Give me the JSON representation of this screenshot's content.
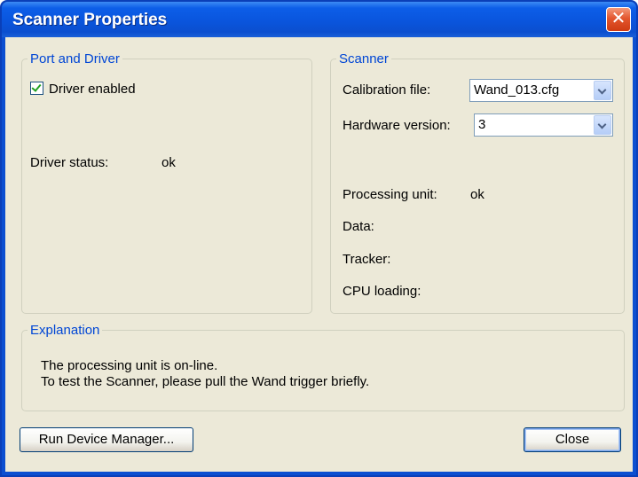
{
  "window": {
    "title": "Scanner Properties",
    "close_glyph": "✕"
  },
  "port_driver": {
    "legend": "Port and Driver",
    "driver_enabled_label": "Driver enabled",
    "driver_enabled_checked": true,
    "driver_status_label": "Driver status:",
    "driver_status_value": "ok"
  },
  "scanner": {
    "legend": "Scanner",
    "calibration_label": "Calibration file:",
    "calibration_value": "Wand_013.cfg",
    "hardware_label": "Hardware version:",
    "hardware_value": "3",
    "processing_label": "Processing unit:",
    "processing_value": "ok",
    "data_label": "Data:",
    "tracker_label": "Tracker:",
    "cpu_label": "CPU loading:"
  },
  "explanation": {
    "legend": "Explanation",
    "line1": "The processing unit is on-line.",
    "line2": "To test the Scanner, please pull the Wand trigger briefly."
  },
  "buttons": {
    "device_manager": "Run Device Manager...",
    "close": "Close"
  },
  "colors": {
    "title_bar": "#0a55dd",
    "legend_text": "#0046d5",
    "dialog_bg": "#ece9d8",
    "close_button": "#d84a22"
  }
}
